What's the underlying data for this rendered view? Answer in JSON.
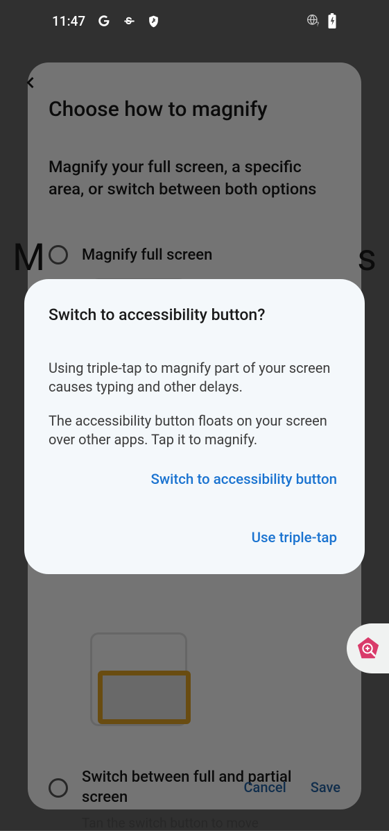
{
  "status_bar": {
    "time": "11:47",
    "icons": {
      "google": "google-icon",
      "s_icon": "s-icon",
      "shield": "shield-icon",
      "globe": "globe-question-icon",
      "battery": "battery-charging-icon"
    }
  },
  "background_panel": {
    "title": "Choose how to magnify",
    "subtitle": "Magnify your full screen, a specific area, or switch between both options",
    "options": [
      {
        "label": "Magnify full screen"
      },
      {
        "label": "Switch between full and partial screen"
      }
    ],
    "truncated_text": "Tan the switch button to move",
    "actions": {
      "cancel": "Cancel",
      "save": "Save"
    }
  },
  "dialog": {
    "title": "Switch to accessibility button?",
    "paragraph1": "Using triple-tap to magnify part of your screen causes typing and other delays.",
    "paragraph2": "The accessibility button floats on your screen over other apps. Tap it to magnify.",
    "action_primary": "Switch to accessibility button",
    "action_secondary": "Use triple-tap"
  },
  "fab": {
    "name": "accessibility-magnify-button"
  }
}
